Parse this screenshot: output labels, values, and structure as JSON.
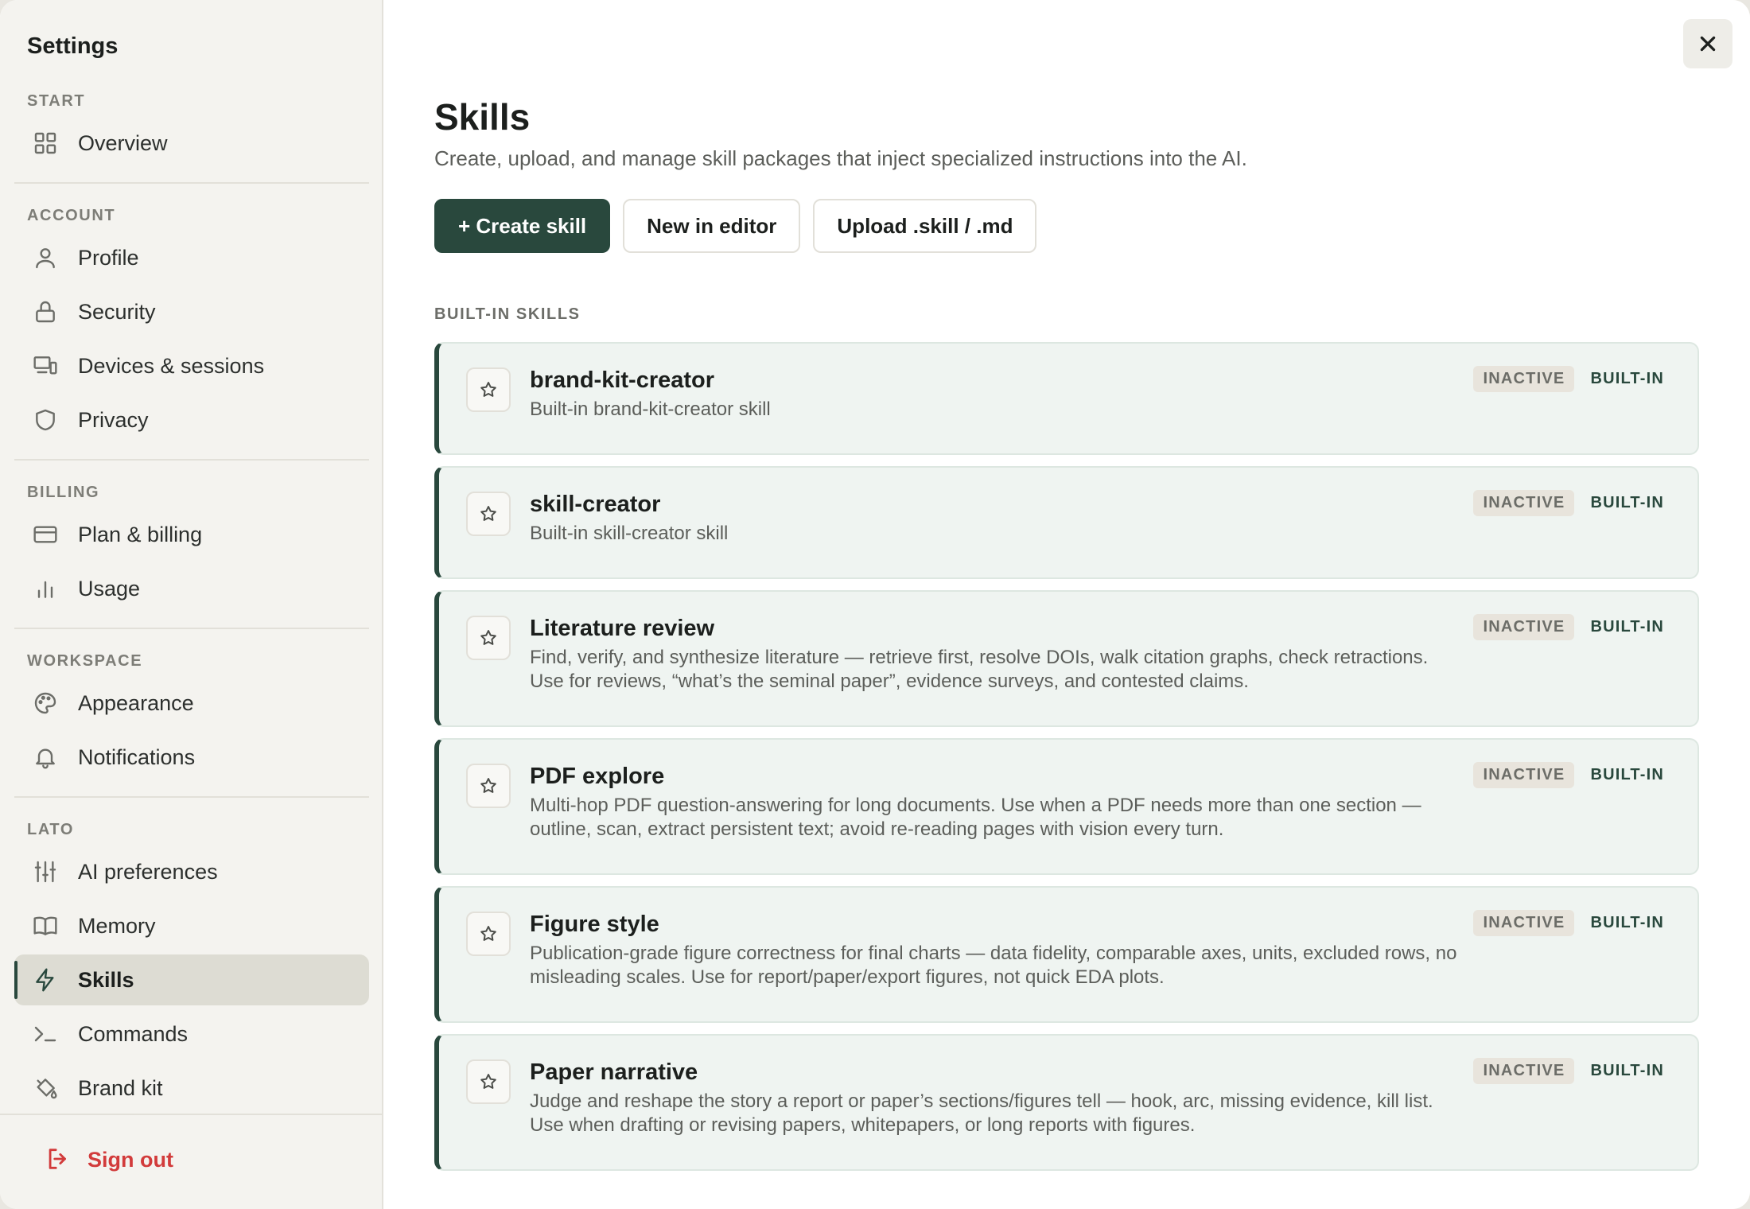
{
  "sidebar": {
    "title": "Settings",
    "sections": {
      "start": "START",
      "account": "ACCOUNT",
      "billing": "BILLING",
      "workspace": "WORKSPACE",
      "lato": "LATO"
    },
    "items": {
      "overview": "Overview",
      "profile": "Profile",
      "security": "Security",
      "devices": "Devices & sessions",
      "privacy": "Privacy",
      "plan": "Plan & billing",
      "usage": "Usage",
      "appearance": "Appearance",
      "notifications": "Notifications",
      "ai_preferences": "AI preferences",
      "memory": "Memory",
      "skills": "Skills",
      "commands": "Commands",
      "brand_kit": "Brand kit"
    },
    "active_item": "skills",
    "sign_out": "Sign out"
  },
  "main": {
    "title": "Skills",
    "subtitle": "Create, upload, and manage skill packages that inject specialized instructions into the AI.",
    "buttons": {
      "create": "+ Create skill",
      "new_editor": "New in editor",
      "upload": "Upload .skill / .md"
    },
    "section_label": "BUILT-IN SKILLS",
    "skills": [
      {
        "name": "brand-kit-creator",
        "description": "Built-in brand-kit-creator skill",
        "status": "INACTIVE",
        "type": "BUILT-IN"
      },
      {
        "name": "skill-creator",
        "description": "Built-in skill-creator skill",
        "status": "INACTIVE",
        "type": "BUILT-IN"
      },
      {
        "name": "Literature review",
        "description": "Find, verify, and synthesize literature — retrieve first, resolve DOIs, walk citation graphs, check retractions. Use for reviews, “what’s the seminal paper”, evidence surveys, and contested claims.",
        "status": "INACTIVE",
        "type": "BUILT-IN"
      },
      {
        "name": "PDF explore",
        "description": "Multi-hop PDF question-answering for long documents. Use when a PDF needs more than one section — outline, scan, extract persistent text; avoid re-reading pages with vision every turn.",
        "status": "INACTIVE",
        "type": "BUILT-IN"
      },
      {
        "name": "Figure style",
        "description": "Publication-grade figure correctness for final charts — data fidelity, comparable axes, units, excluded rows, no misleading scales. Use for report/paper/export figures, not quick EDA plots.",
        "status": "INACTIVE",
        "type": "BUILT-IN"
      },
      {
        "name": "Paper narrative",
        "description": "Judge and reshape the story a report or paper’s sections/figures tell — hook, arc, missing evidence, kill list. Use when drafting or revising papers, whitepapers, or long reports with figures.",
        "status": "INACTIVE",
        "type": "BUILT-IN"
      }
    ]
  },
  "colors": {
    "accent": "#29483d",
    "danger": "#d23b3b",
    "sidebar_bg": "#f4f3ef",
    "card_bg": "#eff4f1"
  }
}
